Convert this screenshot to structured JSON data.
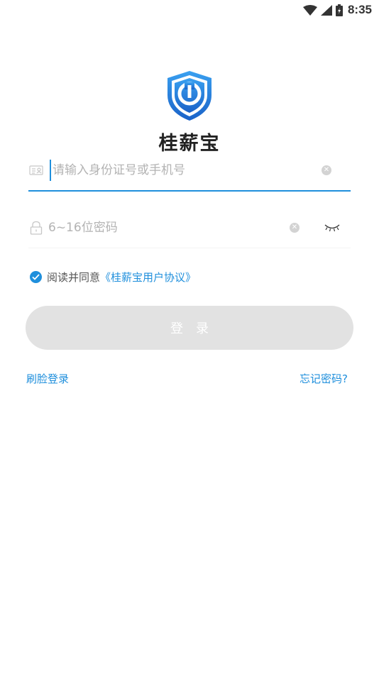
{
  "status_bar": {
    "time": "8:35",
    "icons": [
      "wifi-icon",
      "cellular-signal-icon",
      "battery-icon"
    ]
  },
  "logo": {
    "app_name": "桂薪宝",
    "icon": "shield-wrench-logo"
  },
  "id_field": {
    "icon": "id-card-icon",
    "placeholder": "请输入身份证号或手机号",
    "value": ""
  },
  "password_field": {
    "icon": "lock-icon",
    "placeholder": "6~16位密码",
    "value": ""
  },
  "agreement": {
    "checked": true,
    "text": "阅读并同意",
    "link": "《桂薪宝用户协议》"
  },
  "login_button": "登录",
  "face_login": "刷脸登录",
  "forgot_password": "忘记密码?",
  "colors": {
    "accent": "#1f8fdc",
    "button_disabled": "#e2e2e2",
    "placeholder": "#b3b3b3"
  }
}
